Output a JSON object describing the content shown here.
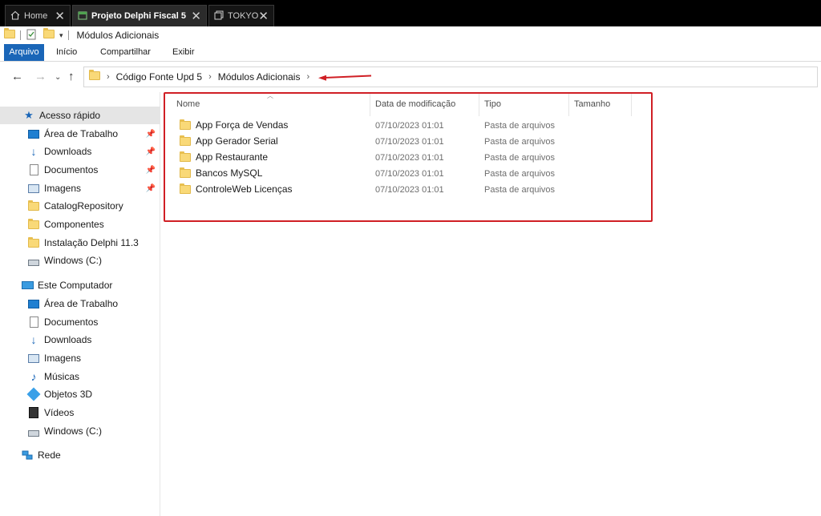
{
  "tabs": [
    {
      "label": "Home",
      "icon": "home-icon"
    },
    {
      "label": "Projeto Delphi Fiscal 5",
      "icon": "folder-window-icon",
      "active": true
    },
    {
      "label": "TOKYO",
      "icon": "copy-icon"
    }
  ],
  "window": {
    "title": "Módulos Adicionais"
  },
  "ribbon": {
    "file": "Arquivo",
    "home": "Início",
    "share": "Compartilhar",
    "view": "Exibir"
  },
  "address": {
    "segments": [
      "Código Fonte Upd 5",
      "Módulos Adicionais"
    ]
  },
  "nav": {
    "quick_access": "Acesso rápido",
    "quick_items": [
      {
        "label": "Área de Trabalho",
        "icon": "desktop-icon",
        "pinned": true
      },
      {
        "label": "Downloads",
        "icon": "download-icon",
        "pinned": true
      },
      {
        "label": "Documentos",
        "icon": "document-icon",
        "pinned": true
      },
      {
        "label": "Imagens",
        "icon": "image-icon",
        "pinned": true
      },
      {
        "label": "CatalogRepository",
        "icon": "folder-icon"
      },
      {
        "label": "Componentes",
        "icon": "folder-icon"
      },
      {
        "label": "Instalação Delphi 11.3",
        "icon": "folder-icon"
      },
      {
        "label": "Windows (C:)",
        "icon": "drive-icon"
      }
    ],
    "this_pc": "Este Computador",
    "pc_items": [
      {
        "label": "Área de Trabalho",
        "icon": "desktop-icon"
      },
      {
        "label": "Documentos",
        "icon": "document-icon"
      },
      {
        "label": "Downloads",
        "icon": "download-icon"
      },
      {
        "label": "Imagens",
        "icon": "image-icon"
      },
      {
        "label": "Músicas",
        "icon": "music-icon"
      },
      {
        "label": "Objetos 3D",
        "icon": "cube-icon"
      },
      {
        "label": "Vídeos",
        "icon": "video-icon"
      },
      {
        "label": "Windows (C:)",
        "icon": "drive-icon"
      }
    ],
    "network": "Rede"
  },
  "columns": {
    "name": "Nome",
    "date": "Data de modificação",
    "type": "Tipo",
    "size": "Tamanho"
  },
  "files": [
    {
      "name": "App Força de Vendas",
      "date": "07/10/2023 01:01",
      "type": "Pasta de arquivos"
    },
    {
      "name": "App Gerador Serial",
      "date": "07/10/2023 01:01",
      "type": "Pasta de arquivos"
    },
    {
      "name": "App Restaurante",
      "date": "07/10/2023 01:01",
      "type": "Pasta de arquivos"
    },
    {
      "name": "Bancos MySQL",
      "date": "07/10/2023 01:01",
      "type": "Pasta de arquivos"
    },
    {
      "name": "ControleWeb Licenças",
      "date": "07/10/2023 01:01",
      "type": "Pasta de arquivos"
    }
  ],
  "colors": {
    "file_tab": "#1a66b8",
    "annotation": "#d01f25",
    "folder": "#f9d978"
  }
}
